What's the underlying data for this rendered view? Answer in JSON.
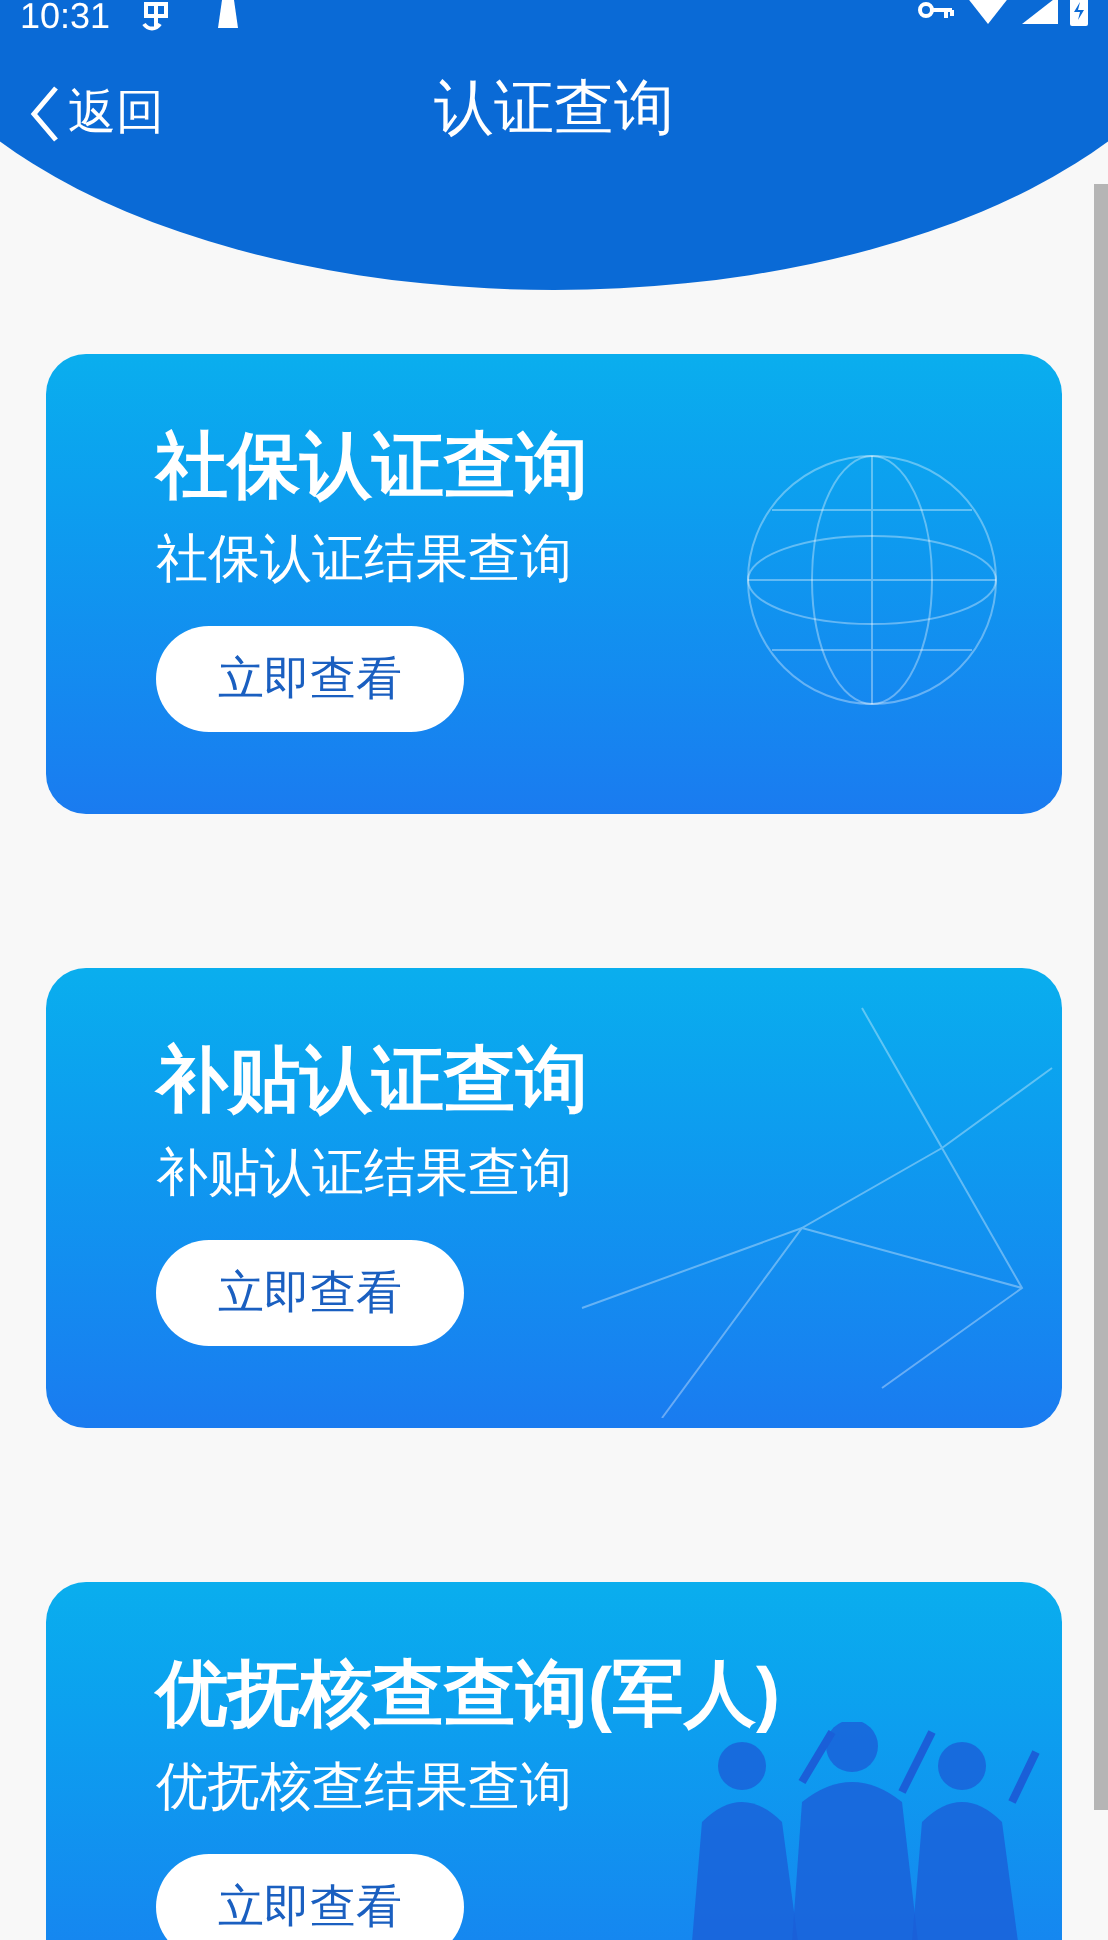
{
  "status_bar": {
    "time": "10:31"
  },
  "nav": {
    "back": "返回",
    "title": "认证查询"
  },
  "cards": [
    {
      "kind": "globe",
      "title": "社保认证查询",
      "subtitle": "社保认证结果查询",
      "button": "立即查看"
    },
    {
      "kind": "network",
      "title": "补贴认证查询",
      "subtitle": "补贴认证结果查询",
      "button": "立即查看"
    },
    {
      "kind": "soldiers",
      "title": "优抚核查查询(军人)",
      "subtitle": "优抚核查结果查询",
      "button": "立即查看"
    }
  ]
}
